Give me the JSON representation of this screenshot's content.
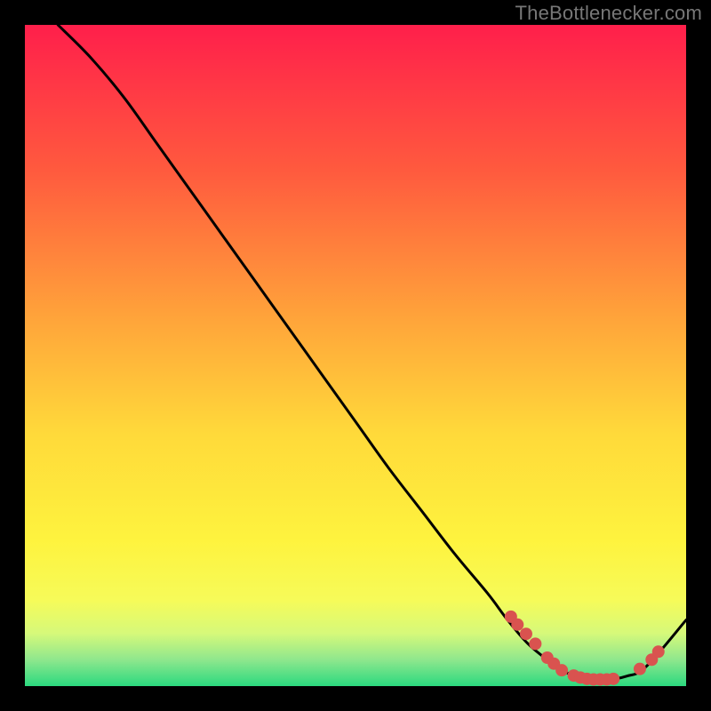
{
  "attribution": "TheBottlenecker.com",
  "chart_data": {
    "type": "line",
    "title": "",
    "xlabel": "",
    "ylabel": "",
    "xlim": [
      0,
      100
    ],
    "ylim": [
      0,
      100
    ],
    "series": [
      {
        "name": "curve",
        "color": "#000000",
        "x": [
          5,
          10,
          15,
          20,
          25,
          30,
          35,
          40,
          45,
          50,
          55,
          60,
          65,
          70,
          73,
          76,
          79,
          82,
          85,
          88,
          91,
          94,
          100
        ],
        "y": [
          100,
          95,
          89,
          82,
          75,
          68,
          61,
          54,
          47,
          40,
          33,
          26.5,
          20,
          14,
          10,
          6.5,
          4,
          2,
          1,
          1,
          1.5,
          3,
          10
        ]
      }
    ],
    "markers": [
      {
        "x": 73.5,
        "y": 10.5
      },
      {
        "x": 74.5,
        "y": 9.3
      },
      {
        "x": 75.8,
        "y": 7.9
      },
      {
        "x": 77.2,
        "y": 6.4
      },
      {
        "x": 79.0,
        "y": 4.3
      },
      {
        "x": 80.0,
        "y": 3.4
      },
      {
        "x": 81.2,
        "y": 2.4
      },
      {
        "x": 83.0,
        "y": 1.6
      },
      {
        "x": 84.0,
        "y": 1.3
      },
      {
        "x": 85.0,
        "y": 1.1
      },
      {
        "x": 86.0,
        "y": 1.0
      },
      {
        "x": 87.0,
        "y": 1.0
      },
      {
        "x": 88.0,
        "y": 1.0
      },
      {
        "x": 89.0,
        "y": 1.1
      },
      {
        "x": 93.0,
        "y": 2.6
      },
      {
        "x": 94.8,
        "y": 4.0
      },
      {
        "x": 95.8,
        "y": 5.2
      }
    ],
    "marker_style": {
      "color": "#d9534f",
      "radius": 7
    },
    "background_gradient": {
      "stops": [
        {
          "offset": 0.0,
          "color": "#ff1f4b"
        },
        {
          "offset": 0.22,
          "color": "#ff5a3e"
        },
        {
          "offset": 0.45,
          "color": "#ffa63a"
        },
        {
          "offset": 0.62,
          "color": "#ffda3a"
        },
        {
          "offset": 0.78,
          "color": "#fef33e"
        },
        {
          "offset": 0.87,
          "color": "#f6fb59"
        },
        {
          "offset": 0.92,
          "color": "#d6f97a"
        },
        {
          "offset": 0.96,
          "color": "#8fe78d"
        },
        {
          "offset": 1.0,
          "color": "#2bd97f"
        }
      ]
    }
  }
}
